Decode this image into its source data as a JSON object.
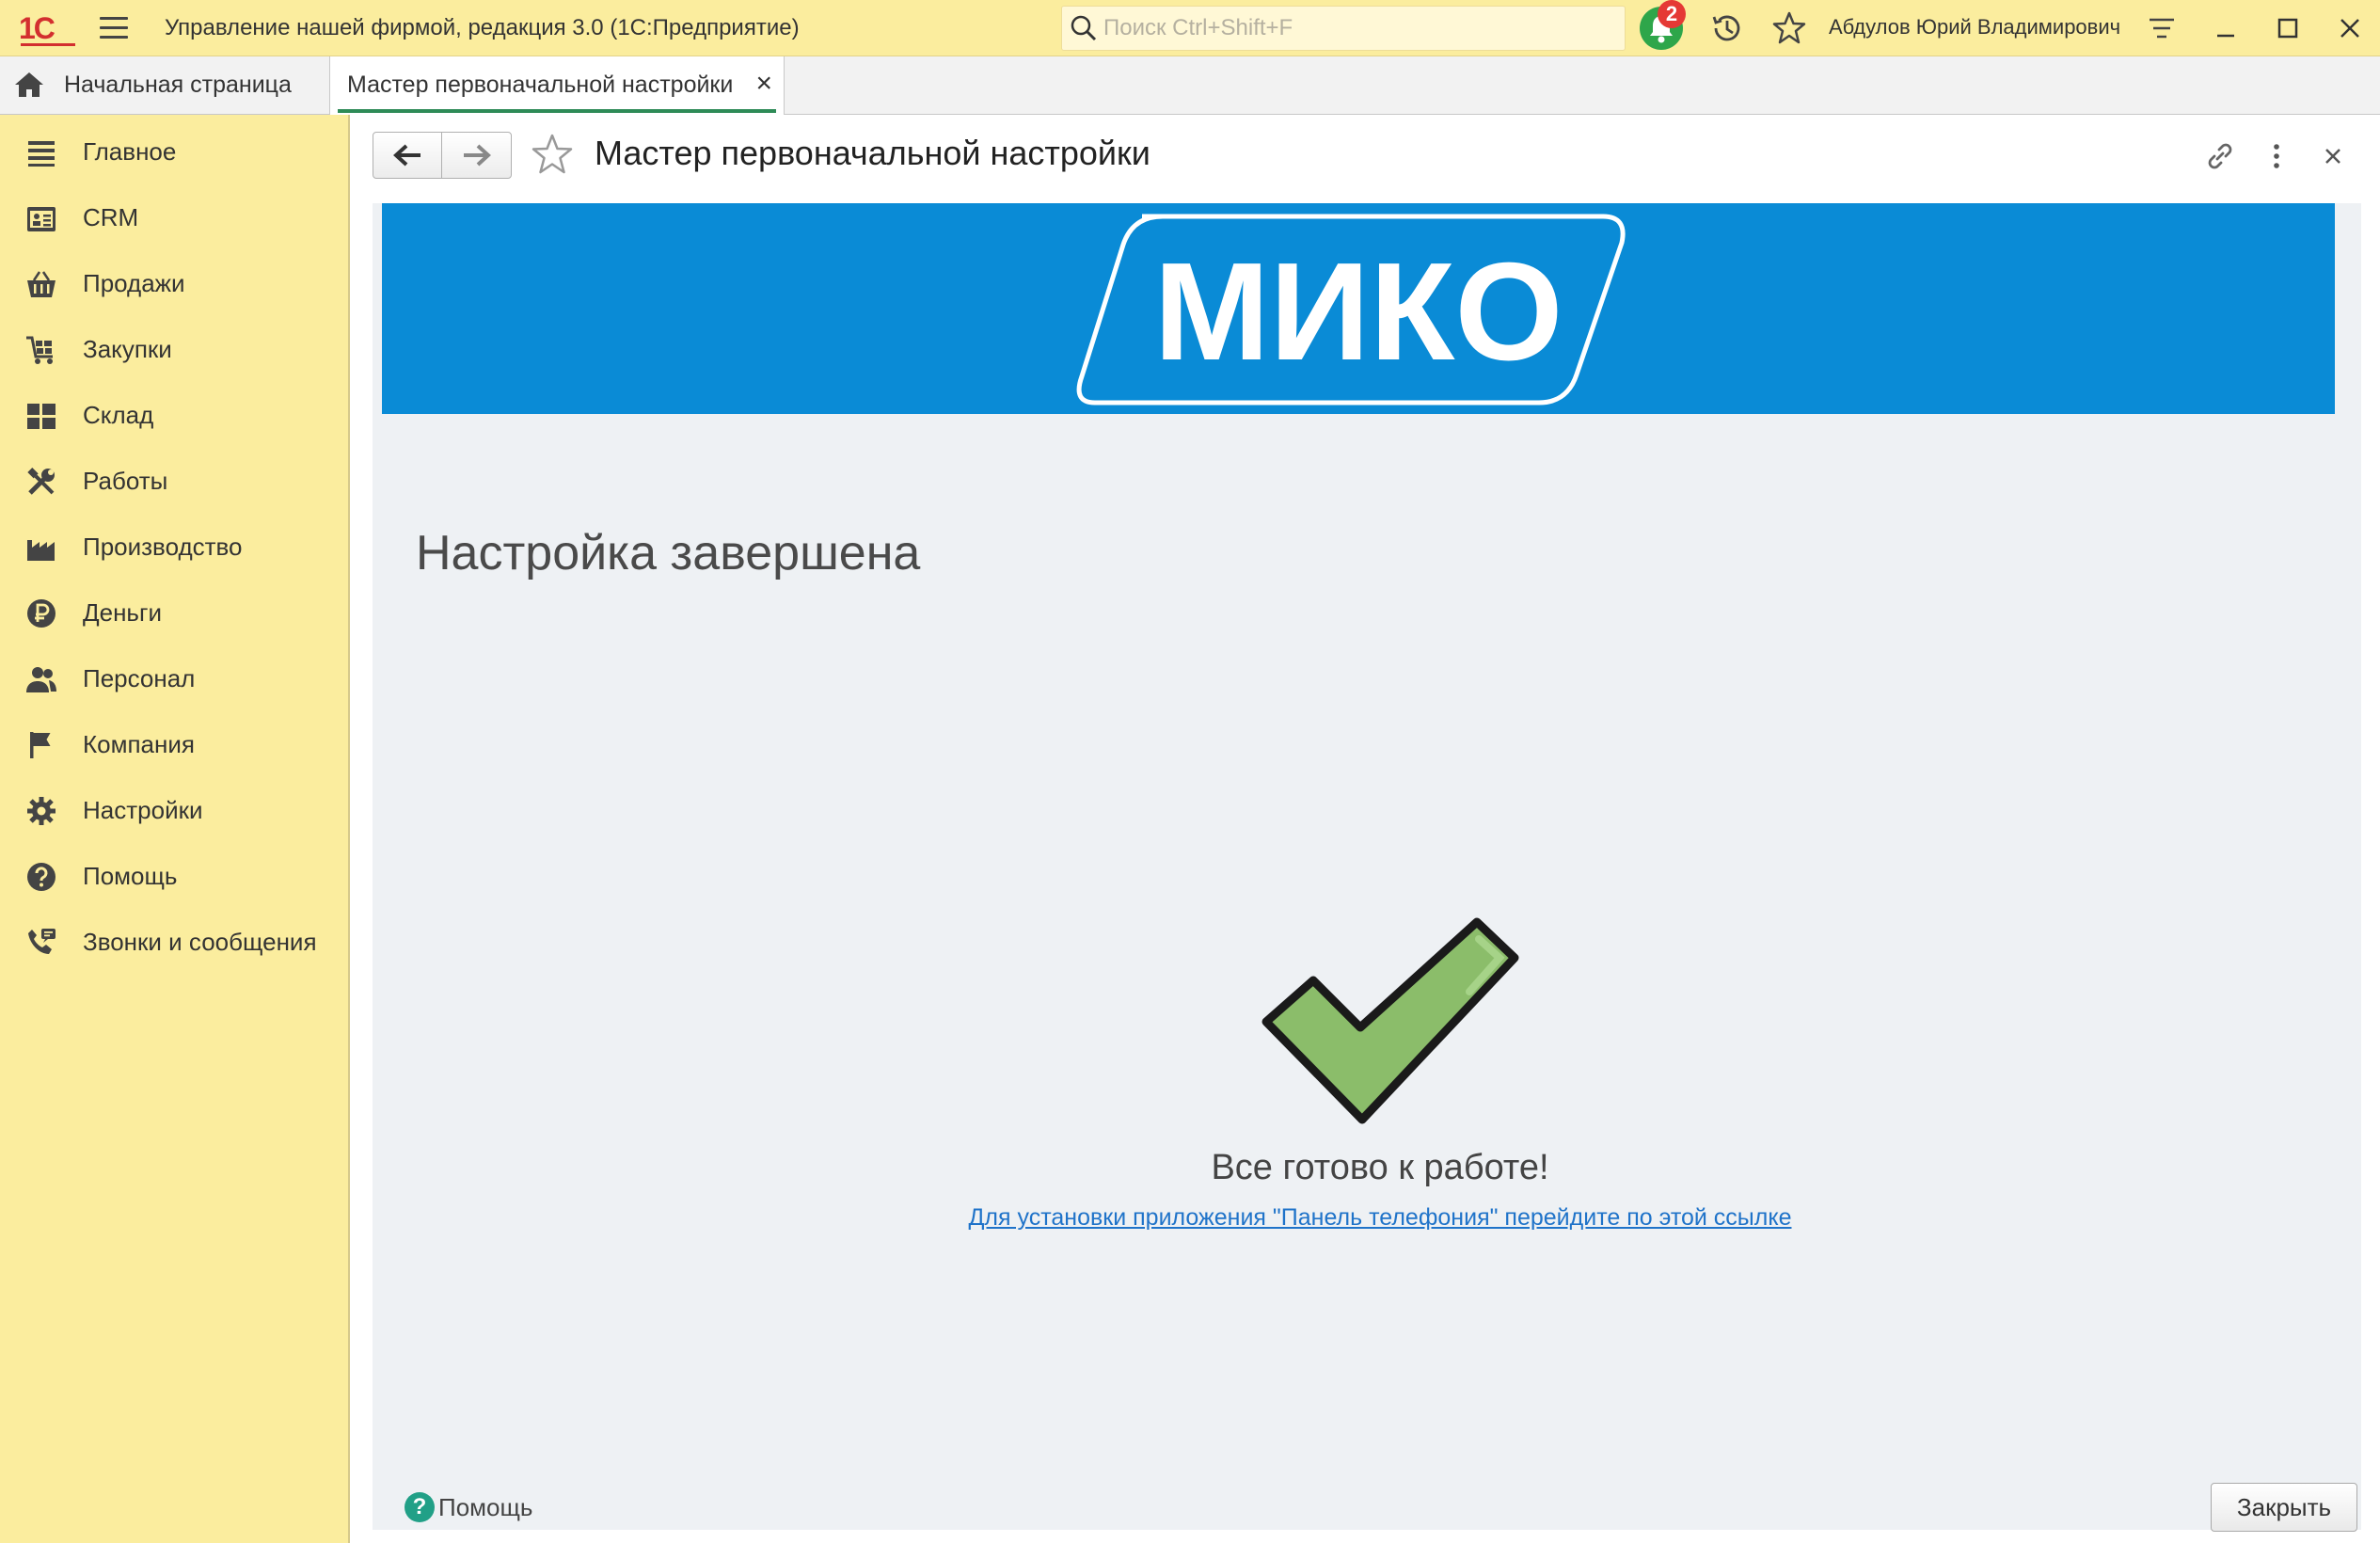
{
  "app": {
    "logo_text": "1С",
    "title": "Управление нашей фирмой, редакция 3.0  (1С:Предприятие)",
    "search_placeholder": "Поиск Ctrl+Shift+F",
    "notifications_count": "2",
    "user_name": "Абдулов Юрий Владимирович",
    "icons": [
      "menu-icon",
      "search-icon",
      "bell-icon",
      "history-icon",
      "star-icon",
      "settings-list-icon",
      "minimize-icon",
      "maximize-icon",
      "close-icon"
    ]
  },
  "tabs": [
    {
      "label": "Начальная страница",
      "active": false
    },
    {
      "label": "Мастер первоначальной настройки",
      "active": true,
      "close": "×"
    }
  ],
  "sidebar": {
    "items": [
      {
        "label": "Главное",
        "icon": "list-icon"
      },
      {
        "label": "CRM",
        "icon": "contacts-icon"
      },
      {
        "label": "Продажи",
        "icon": "basket-icon"
      },
      {
        "label": "Закупки",
        "icon": "cart-icon"
      },
      {
        "label": "Склад",
        "icon": "warehouse-icon"
      },
      {
        "label": "Работы",
        "icon": "tools-icon"
      },
      {
        "label": "Производство",
        "icon": "factory-icon"
      },
      {
        "label": "Деньги",
        "icon": "ruble-icon"
      },
      {
        "label": "Персонал",
        "icon": "people-icon"
      },
      {
        "label": "Компания",
        "icon": "flag-icon"
      },
      {
        "label": "Настройки",
        "icon": "gear-icon"
      },
      {
        "label": "Помощь",
        "icon": "help-icon"
      },
      {
        "label": "Звонки и сообщения",
        "icon": "phone-icon"
      }
    ]
  },
  "form": {
    "title": "Мастер первоначальной настройки",
    "banner_text": "МИКО",
    "section_title": "Настройка завершена",
    "ready_text": "Все готово к работе!",
    "link_text": "Для установки приложения \"Панель телефония\" перейдите по этой ссылке",
    "help_label": "Помощь",
    "close_label": "Закрыть",
    "colors": {
      "banner": "#0a8bd6",
      "sidebar": "#fbed9e",
      "check": "#8bbd6a",
      "link": "#1f73c9"
    }
  }
}
